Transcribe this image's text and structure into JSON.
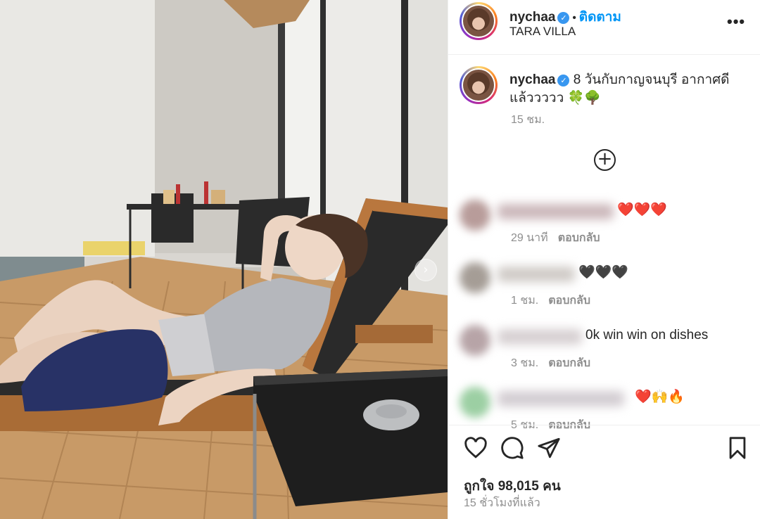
{
  "post": {
    "username": "nychaa",
    "follow_label": "ติดตาม",
    "location": "TARA VILLA",
    "more_label": "•••",
    "caption_text": "8 วันกับกาญจนบุรี อากาศดีแล้ววววว 🍀🌳",
    "caption_time": "15 ชม.",
    "add_comment_icon": "plus-circle-icon",
    "likes": "ถูกใจ 98,015 คน",
    "post_time": "15 ชั่วโมงที่แล้ว"
  },
  "comments": [
    {
      "text": "❤️❤️❤️",
      "time": "29 นาที",
      "reply": "ตอบกลับ"
    },
    {
      "text": "🖤🖤🖤",
      "time": "1 ชม.",
      "reply": "ตอบกลับ"
    },
    {
      "text": "0k win win on dishes",
      "time": "3 ชม.",
      "reply": "ตอบกลับ"
    },
    {
      "text": "❤️🙌🔥",
      "time": "5 ชม.",
      "reply": "ตอบกลับ"
    }
  ],
  "colors": {
    "link_blue": "#0095f6",
    "verified_blue": "#3897f0",
    "muted_text": "#8e8e8e"
  },
  "icons": [
    "like-icon",
    "comment-icon",
    "share-icon",
    "bookmark-icon",
    "next-arrow-icon",
    "verified-badge-icon"
  ]
}
